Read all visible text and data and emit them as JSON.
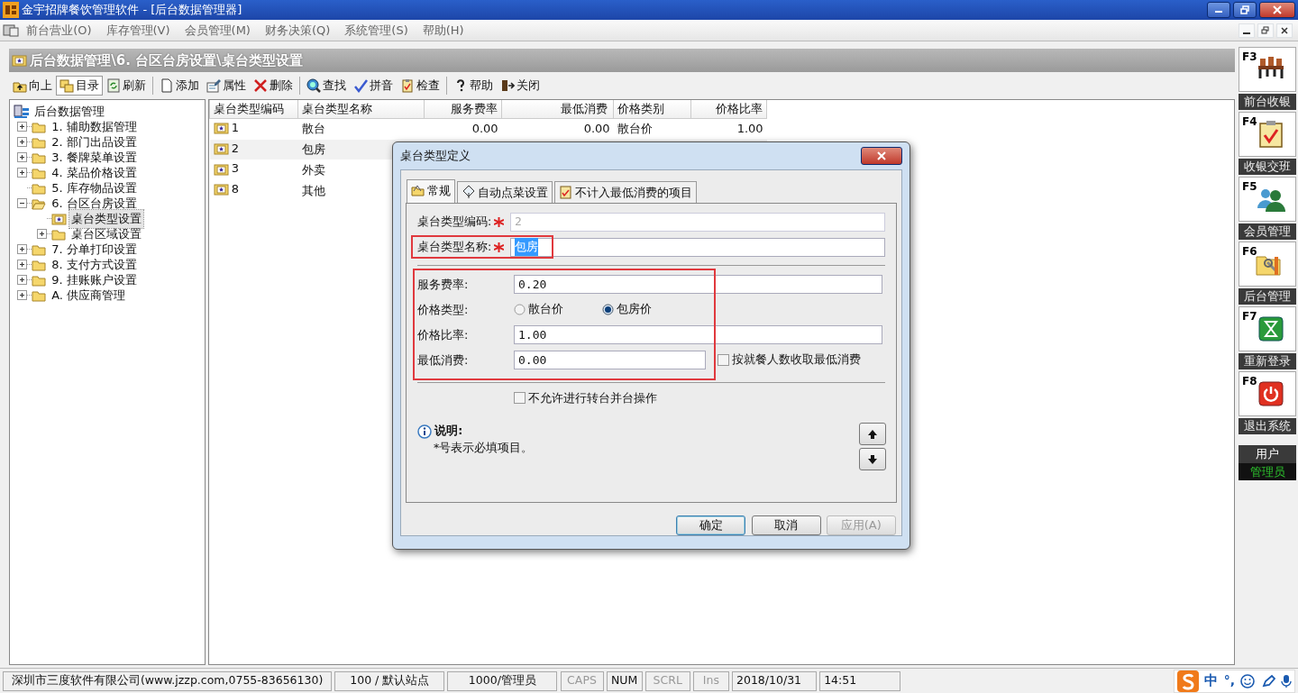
{
  "window": {
    "title": "金宇招牌餐饮管理软件 - [后台数据管理器]"
  },
  "menu": [
    "前台营业(O)",
    "库存管理(V)",
    "会员管理(M)",
    "财务决策(Q)",
    "系统管理(S)",
    "帮助(H)"
  ],
  "breadcrumb": "后台数据管理\\6. 台区台房设置\\桌台类型设置",
  "toolbar": [
    {
      "kind": "button",
      "label": "向上",
      "pressed": false
    },
    {
      "kind": "button",
      "label": "目录",
      "pressed": true
    },
    {
      "kind": "button",
      "label": "刷新",
      "pressed": false
    },
    {
      "kind": "separator"
    },
    {
      "kind": "button",
      "label": "添加",
      "pressed": false
    },
    {
      "kind": "button",
      "label": "属性",
      "pressed": false
    },
    {
      "kind": "button",
      "label": "删除",
      "pressed": false
    },
    {
      "kind": "separator"
    },
    {
      "kind": "button",
      "label": "查找",
      "pressed": false
    },
    {
      "kind": "button",
      "label": "拼音",
      "pressed": false
    },
    {
      "kind": "button",
      "label": "检查",
      "pressed": false
    },
    {
      "kind": "separator"
    },
    {
      "kind": "button",
      "label": "帮助",
      "pressed": false
    },
    {
      "kind": "button",
      "label": "关闭",
      "pressed": false
    }
  ],
  "tree": {
    "label": "后台数据管理",
    "children": [
      {
        "label": "1. 辅助数据管理",
        "kind": "collapsed",
        "selected": false
      },
      {
        "label": "2. 部门出品设置",
        "kind": "collapsed",
        "selected": false
      },
      {
        "label": "3. 餐牌菜单设置",
        "kind": "collapsed",
        "selected": false
      },
      {
        "label": "4. 菜品价格设置",
        "kind": "collapsed",
        "selected": false
      },
      {
        "label": "5. 库存物品设置",
        "kind": "leaf",
        "selected": false
      },
      {
        "label": "6. 台区台房设置",
        "kind": "expanded",
        "selected": false,
        "children": [
          {
            "label": "桌台类型设置",
            "kind": "item",
            "selected": true
          },
          {
            "label": "桌台区域设置",
            "kind": "collapsed",
            "selected": false
          }
        ]
      },
      {
        "label": "7. 分单打印设置",
        "kind": "collapsed",
        "selected": false
      },
      {
        "label": "8. 支付方式设置",
        "kind": "collapsed",
        "selected": false
      },
      {
        "label": "9. 挂账账户设置",
        "kind": "collapsed",
        "selected": false
      },
      {
        "label": "A. 供应商管理",
        "kind": "collapsed",
        "selected": false
      }
    ]
  },
  "table": {
    "columns": [
      "桌台类型编码",
      "桌台类型名称",
      "服务费率",
      "最低消费",
      "价格类别",
      "价格比率"
    ],
    "rows": [
      {
        "selected": false,
        "cells": [
          "1",
          "散台",
          "0.00",
          "0.00",
          "散台价",
          "1.00"
        ]
      },
      {
        "selected": true,
        "cells": [
          "2",
          "包房"
        ]
      },
      {
        "selected": false,
        "cells": [
          "3",
          "外卖"
        ]
      },
      {
        "selected": false,
        "cells": [
          "8",
          "其他"
        ]
      }
    ]
  },
  "dialog": {
    "title": "桌台类型定义",
    "tabs": [
      {
        "label": "常规",
        "selected": true
      },
      {
        "label": "自动点菜设置",
        "selected": false
      },
      {
        "label": "不计入最低消费的项目",
        "selected": false
      }
    ],
    "fields": [
      {
        "kind": "text",
        "label": "桌台类型编码:",
        "required": true,
        "value": "2",
        "disabled": true,
        "value_selected": false
      },
      {
        "kind": "text",
        "label": "桌台类型名称:",
        "required": true,
        "value": "包房",
        "disabled": false,
        "value_selected": true,
        "highlighted": true
      }
    ],
    "pricing": {
      "highlighted": true,
      "rows": [
        {
          "kind": "text",
          "label": "服务费率:",
          "value": "0.20"
        },
        {
          "kind": "radio",
          "label": "价格类型:",
          "options": [
            {
              "label": "散台价",
              "selected": false
            },
            {
              "label": "包房价",
              "selected": true
            }
          ]
        },
        {
          "kind": "text",
          "label": "价格比率:",
          "value": "1.00"
        },
        {
          "kind": "short-text",
          "label": "最低消费:",
          "value": "0.00",
          "check": {
            "label": "按就餐人数收取最低消费",
            "checked": false
          }
        }
      ]
    },
    "option": {
      "label": "不允许进行转台并台操作",
      "checked": false
    },
    "note": {
      "title": "说明:",
      "text": "*号表示必填项目。"
    },
    "buttons": [
      {
        "label": "确定",
        "default": true,
        "disabled": false
      },
      {
        "label": "取消",
        "default": false,
        "disabled": false
      },
      {
        "label": "应用(A)",
        "default": false,
        "disabled": true
      }
    ]
  },
  "sidebar": [
    {
      "key": "F3",
      "label": "前台收银"
    },
    {
      "key": "F4",
      "label": "收银交班"
    },
    {
      "key": "F5",
      "label": "会员管理"
    },
    {
      "key": "F6",
      "label": "后台管理"
    },
    {
      "key": "F7",
      "label": "重新登录"
    },
    {
      "key": "F8",
      "label": "退出系统"
    }
  ],
  "user": {
    "title": "用户",
    "name": "管理员"
  },
  "status_bar": [
    {
      "text": "深圳市三度软件有限公司(www.jzzp.com,0755-83656130)",
      "dimmed": false
    },
    {
      "text": "100 / 默认站点",
      "dimmed": false
    },
    {
      "text": "1000/管理员",
      "dimmed": false
    },
    {
      "text": "CAPS",
      "dimmed": true
    },
    {
      "text": "NUM",
      "dimmed": false
    },
    {
      "text": "SCRL",
      "dimmed": true
    },
    {
      "text": "Ins",
      "dimmed": true
    },
    {
      "text": "2018/10/31",
      "dimmed": false
    },
    {
      "text": "14:51",
      "dimmed": false
    }
  ],
  "ime": {
    "mode": "中",
    "punct": "°,"
  }
}
